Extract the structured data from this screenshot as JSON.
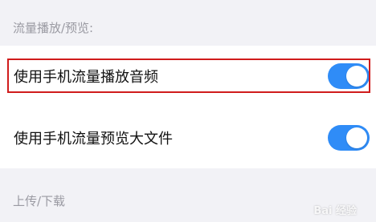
{
  "sections": {
    "streaming_header": "流量播放/预览:",
    "upload_download_header": "上传/下载"
  },
  "settings": {
    "items": [
      {
        "label": "使用手机流量播放音频",
        "enabled": true
      },
      {
        "label": "使用手机流量预览大文件",
        "enabled": true
      }
    ]
  },
  "colors": {
    "toggle_on": "#2f8cf7",
    "highlight_border": "#d01c1c",
    "background": "#f2f2f6"
  },
  "watermark": {
    "text": "Bai 经验"
  }
}
